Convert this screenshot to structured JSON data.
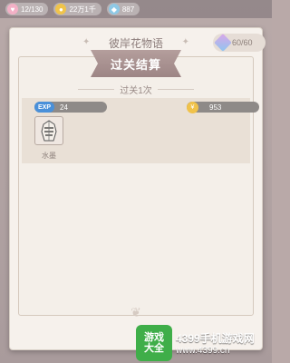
{
  "top_bar": {
    "stamina": "12/130",
    "coins": "22万1千",
    "gems": "887"
  },
  "panel": {
    "title": "彼岸花物语",
    "counter": "60/60"
  },
  "result": {
    "ribbon": "过关结算",
    "clear_count": "过关1次",
    "exp_label": "EXP",
    "exp_value": "24",
    "coin_value": "953",
    "item": {
      "name": "水墨",
      "icon": "ink-outfit-icon"
    }
  },
  "watermark": {
    "logo_line1": "游戏",
    "logo_line2": "大全",
    "site_name": "4399手机游戏网",
    "url": "www.4399.cn"
  },
  "colors": {
    "ribbon": "#a58f8e",
    "exp_badge": "#4a90d9",
    "coin": "#f0c24a",
    "watermark_green": "#3fae49"
  }
}
